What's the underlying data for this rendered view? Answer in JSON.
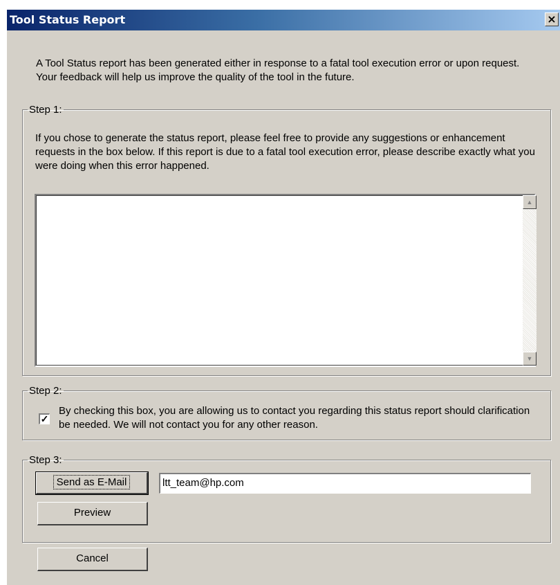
{
  "window": {
    "title": "Tool Status Report",
    "close_glyph": "×"
  },
  "intro_text": "A Tool Status report has been generated either in response to a fatal tool execution error or upon request. Your feedback will help us improve the quality of the tool in the future.",
  "step1": {
    "legend": "Step 1:",
    "text": "If you chose to generate the status report, please feel free to provide any suggestions or enhancement requests in the box below.  If this report is due to a fatal tool execution error, please describe exactly what you were doing when this error happened.",
    "feedback_value": ""
  },
  "step2": {
    "legend": "Step 2:",
    "checked": true,
    "check_mark": "✓",
    "text": "By checking this box, you are allowing us to contact you regarding this status report should clarification be needed.  We will not contact you for any other reason."
  },
  "step3": {
    "legend": "Step 3:",
    "send_email_label": "Send as E-Mail",
    "email_value": "ltt_team@hp.com",
    "preview_label": "Preview"
  },
  "cancel_label": "Cancel",
  "icons": {
    "scroll_up": "▲",
    "scroll_down": "▼"
  }
}
